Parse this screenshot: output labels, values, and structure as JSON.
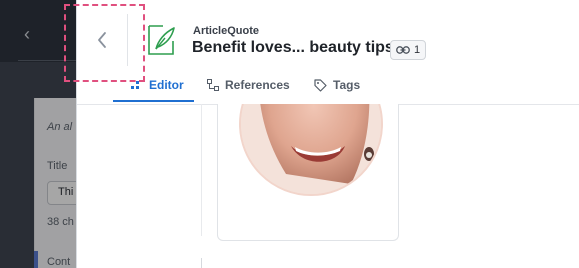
{
  "background_editor": {
    "italic_snippet": "An al",
    "title_label": "Title",
    "title_value": "Thi",
    "char_count": "38 ch",
    "content_label": "Cont"
  },
  "header": {
    "content_type": "ArticleQuote",
    "entry_title": "Benefit loves... beauty tips",
    "reference_count": "1"
  },
  "tabs": [
    {
      "label": "Editor",
      "icon": "editor-icon",
      "active": true
    },
    {
      "label": "References",
      "icon": "references-icon",
      "active": false
    },
    {
      "label": "Tags",
      "icon": "tag-icon",
      "active": false
    }
  ],
  "colors": {
    "accent": "#1f6fd1",
    "quote_icon": "#2e9e4f",
    "highlight": "#e0507f"
  }
}
